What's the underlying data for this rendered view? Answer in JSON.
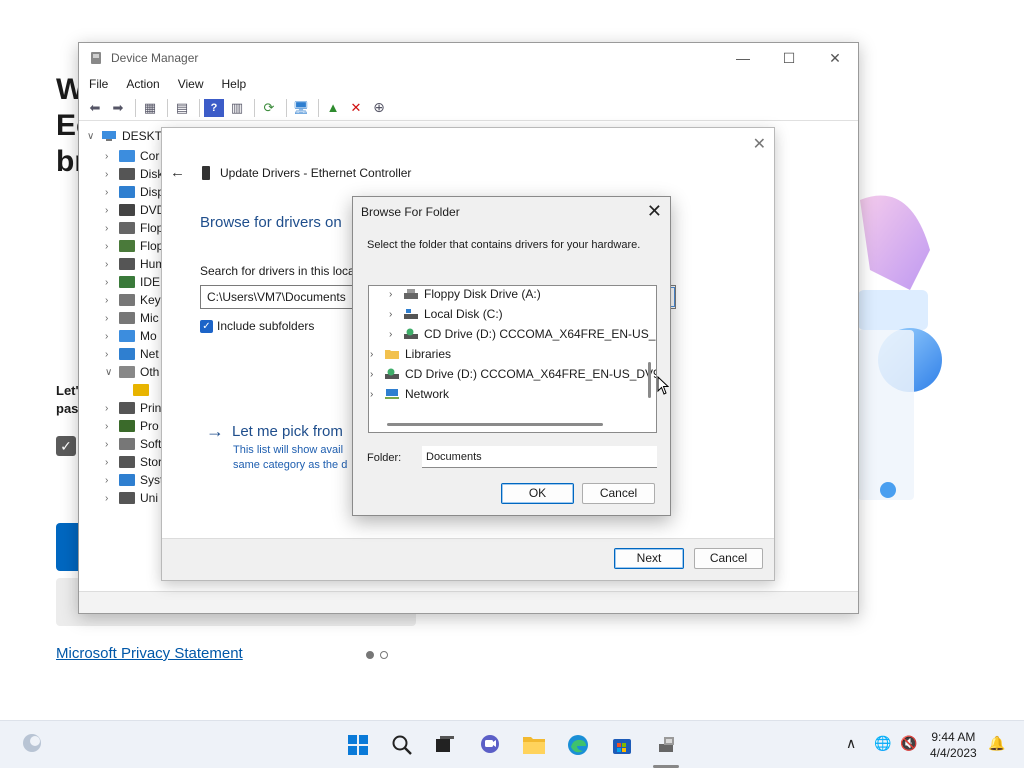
{
  "background": {
    "title_lines": [
      "W",
      "Ec",
      "br"
    ],
    "sub_lines": [
      "Let'",
      "pas"
    ],
    "privacy_link": "Microsoft Privacy Statement"
  },
  "device_manager": {
    "title": "Device Manager",
    "menu": [
      "File",
      "Action",
      "View",
      "Help"
    ],
    "tree_root": "DESKTO",
    "tree_items": [
      {
        "label": "Cor",
        "icon": "monitor-icon",
        "color": "#3c8dde"
      },
      {
        "label": "Disk",
        "icon": "disk-icon",
        "color": "#555555"
      },
      {
        "label": "Disp",
        "icon": "display-icon",
        "color": "#2f7fd0"
      },
      {
        "label": "DVD",
        "icon": "dvd-icon",
        "color": "#444444"
      },
      {
        "label": "Flop",
        "icon": "floppy-icon",
        "color": "#666666"
      },
      {
        "label": "Flop",
        "icon": "floppy-controller-icon",
        "color": "#4a7a3a"
      },
      {
        "label": "Hum",
        "icon": "hid-icon",
        "color": "#555555"
      },
      {
        "label": "IDE",
        "icon": "ide-icon",
        "color": "#3a7a3a"
      },
      {
        "label": "Key",
        "icon": "keyboard-icon",
        "color": "#777777"
      },
      {
        "label": "Mic",
        "icon": "mouse-icon",
        "color": "#777777"
      },
      {
        "label": "Mo",
        "icon": "monitor-icon",
        "color": "#3c8dde"
      },
      {
        "label": "Net",
        "icon": "network-adapter-icon",
        "color": "#2f7fd0"
      },
      {
        "label": "Oth",
        "icon": "other-devices-icon",
        "color": "#888888",
        "expanded": true
      },
      {
        "label": "",
        "icon": "warning-device-icon",
        "color": "#e8b400",
        "child": true
      },
      {
        "label": "Prin",
        "icon": "printer-icon",
        "color": "#555555"
      },
      {
        "label": "Pro",
        "icon": "processor-icon",
        "color": "#3a6a2a"
      },
      {
        "label": "Soft",
        "icon": "software-device-icon",
        "color": "#777777"
      },
      {
        "label": "Stor",
        "icon": "storage-icon",
        "color": "#555555"
      },
      {
        "label": "Syst",
        "icon": "system-icon",
        "color": "#2f7fd0"
      },
      {
        "label": "Uni",
        "icon": "usb-icon",
        "color": "#555555"
      }
    ]
  },
  "wizard": {
    "header": "Update Drivers - Ethernet Controller",
    "browse_title": "Browse for drivers on",
    "search_label": "Search for drivers in this locat",
    "path_value": "C:\\Users\\VM7\\Documents",
    "include_subfolders": "Include subfolders",
    "pick_link": "Let me pick from",
    "pick_desc_1": "This list will show avail",
    "pick_desc_2": "same category as the d",
    "next": "Next",
    "cancel": "Cancel"
  },
  "browse_folder": {
    "title": "Browse For Folder",
    "instruction": "Select the folder that contains drivers for your hardware.",
    "tree": [
      {
        "label": "Floppy Disk Drive (A:)",
        "icon": "floppy-drive-icon",
        "level": 1
      },
      {
        "label": "Local Disk (C:)",
        "icon": "local-disk-icon",
        "level": 1
      },
      {
        "label": "CD Drive (D:) CCCOMA_X64FRE_EN-US_",
        "icon": "cd-drive-icon",
        "level": 1
      },
      {
        "label": "Libraries",
        "icon": "libraries-folder-icon",
        "level": 0
      },
      {
        "label": "CD Drive (D:) CCCOMA_X64FRE_EN-US_DV9",
        "icon": "cd-drive-icon",
        "level": 0
      },
      {
        "label": "Network",
        "icon": "network-icon",
        "level": 0
      }
    ],
    "folder_label": "Folder:",
    "folder_value": "Documents",
    "ok": "OK",
    "cancel": "Cancel"
  },
  "taskbar": {
    "time": "9:44 AM",
    "date": "4/4/2023"
  }
}
